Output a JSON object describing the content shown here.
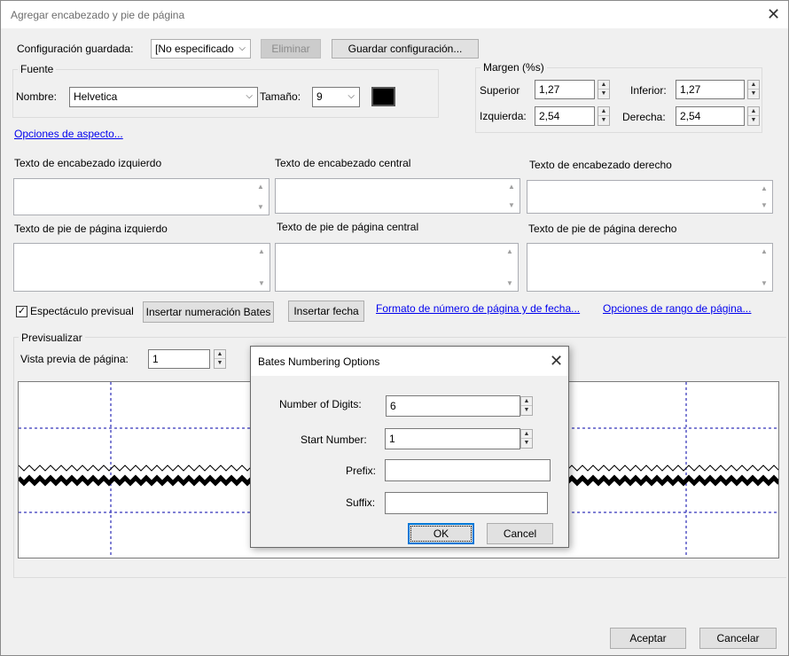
{
  "window": {
    "title": "Agregar encabezado y pie de página",
    "close_glyph": "✕"
  },
  "saved_config": {
    "label": "Configuración guardada:",
    "value": "[No especificado",
    "delete_label": "Eliminar",
    "save_label": "Guardar configuración..."
  },
  "font": {
    "group_title": "Fuente",
    "name_label": "Nombre:",
    "name_value": "Helvetica",
    "size_label": "Tamaño:",
    "size_value": "9",
    "color": "#000000"
  },
  "margin": {
    "group_title": "Margen (%s)",
    "top_label": "Superior",
    "top_value": "1,27",
    "bottom_label": "Inferior:",
    "bottom_value": "1,27",
    "left_label": "Izquierda:",
    "left_value": "2,54",
    "right_label": "Derecha:",
    "right_value": "2,54"
  },
  "appearance_link": "Opciones de aspecto...",
  "text_boxes": {
    "header_left": "Texto de encabezado izquierdo",
    "header_center": "Texto de encabezado central",
    "header_right": "Texto de encabezado derecho",
    "footer_left": "Texto de pie de página izquierdo",
    "footer_center": "Texto de pie de página central",
    "footer_right": "Texto de pie de página derecho"
  },
  "options_row": {
    "preview_checkbox_label": "Espectáculo previsual",
    "preview_checked_glyph": "✓",
    "insert_bates_label": "Insertar numeración Bates",
    "insert_date_label": "Insertar fecha",
    "page_number_format_link": "Formato de número de página y de fecha...",
    "page_range_link": "Opciones de rango de página..."
  },
  "preview": {
    "group_title": "Previsualizar",
    "page_preview_label": "Vista previa de página:",
    "page_preview_value": "1"
  },
  "bates_dialog": {
    "title": "Bates Numbering Options",
    "close_glyph": "✕",
    "digits_label": "Number of Digits:",
    "digits_value": "6",
    "start_label": "Start Number:",
    "start_value": "1",
    "prefix_label": "Prefix:",
    "prefix_value": "",
    "suffix_label": "Suffix:",
    "suffix_value": "",
    "ok_label": "OK",
    "cancel_label": "Cancel"
  },
  "footer": {
    "accept_label": "Aceptar",
    "cancel_label": "Cancelar"
  },
  "icons": {
    "spin_up": "▲",
    "spin_down": "▼",
    "dropdown": "⌵",
    "scroll_up": "▲",
    "scroll_down": "▼"
  }
}
